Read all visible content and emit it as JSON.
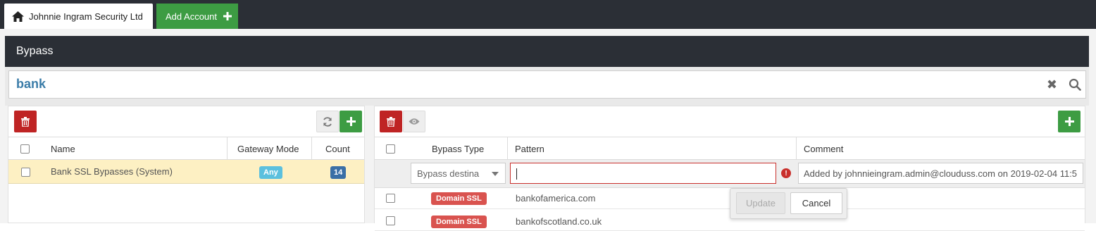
{
  "tabs": {
    "home_label": "Johnnie Ingram Security Ltd",
    "add_account_label": "Add Account"
  },
  "section": {
    "title": "Bypass"
  },
  "search": {
    "value": "bank"
  },
  "left_table": {
    "columns": [
      "Name",
      "Gateway Mode",
      "Count"
    ],
    "rows": [
      {
        "name": "Bank SSL Bypasses (System)",
        "gateway_mode": "Any",
        "count": "14"
      }
    ]
  },
  "right_table": {
    "columns": [
      "Bypass Type",
      "Pattern",
      "Comment"
    ],
    "edit_row": {
      "bypass_type": "Bypass destina",
      "pattern": "",
      "comment": "Added by johnnieingram.admin@clouduss.com on 2019-02-04 11:5"
    },
    "rows": [
      {
        "type": "Domain SSL",
        "pattern": "bankofamerica.com"
      },
      {
        "type": "Domain SSL",
        "pattern": "bankofscotland.co.uk"
      }
    ]
  },
  "popover": {
    "update_label": "Update",
    "cancel_label": "Cancel"
  },
  "colors": {
    "dark_bar": "#2b2f36",
    "green": "#3d9c43",
    "red": "#bf2424",
    "selected_row": "#fdf0c3",
    "badge_any": "#5bc0de",
    "badge_count": "#3a6fa6",
    "badge_domain": "#d9534f",
    "search_text": "#3a7ca8"
  },
  "icons": [
    "home-icon",
    "plus-icon",
    "clear-icon",
    "search-icon",
    "trash-icon",
    "refresh-icon",
    "eye-icon",
    "error-icon",
    "dropdown-arrow-icon"
  ]
}
